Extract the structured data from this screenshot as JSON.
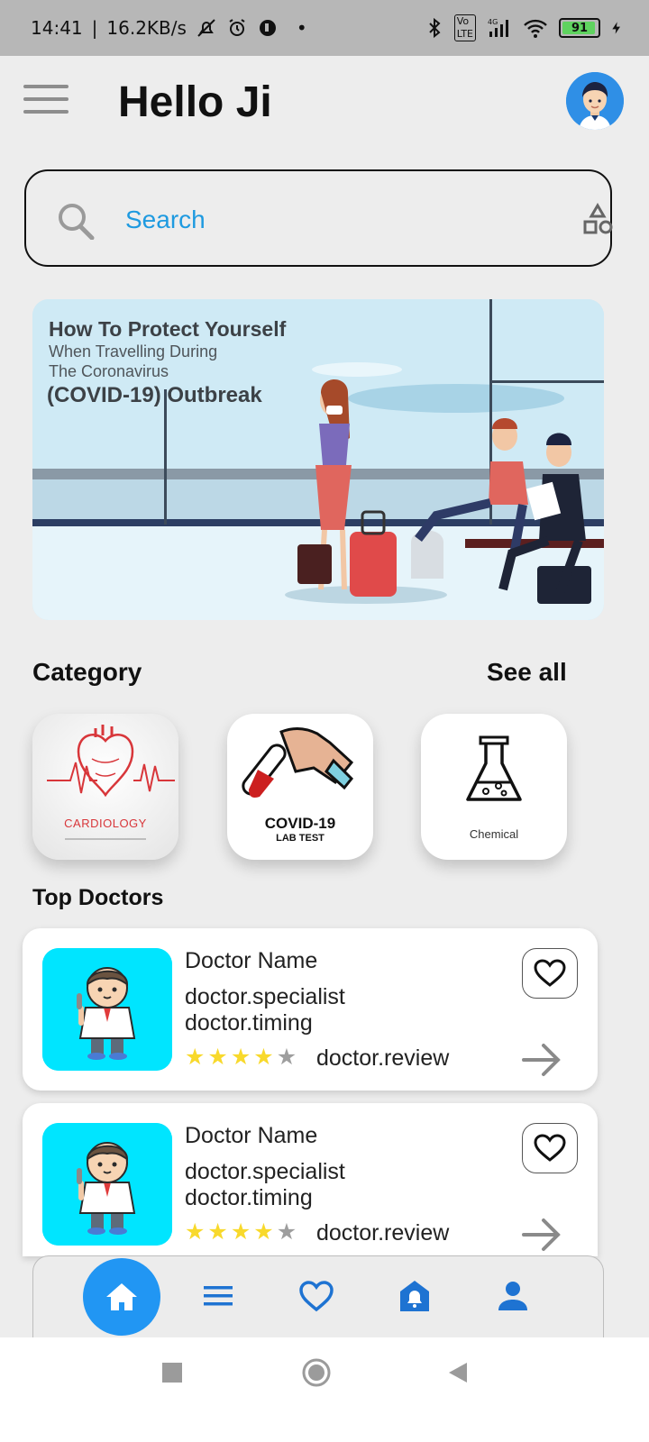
{
  "status_bar": {
    "time": "14:41",
    "speed": "16.2KB/s",
    "network_tag": "Vo LTE",
    "network_gen": "4G",
    "battery": "91"
  },
  "header": {
    "greeting": "Hello Ji"
  },
  "search": {
    "placeholder": "Search"
  },
  "banner": {
    "line1": "How To Protect Yourself",
    "line2": "When Travelling During",
    "line3": "The Coronavirus",
    "line4": "(COVID-19) Outbreak"
  },
  "category": {
    "title": "Category",
    "see_all": "See all",
    "items": [
      {
        "label": "CARDIOLOGY"
      },
      {
        "label": "COVID-19",
        "sublabel": "LAB TEST"
      },
      {
        "label": "Chemical"
      }
    ]
  },
  "top_doctors": {
    "title": "Top Doctors",
    "items": [
      {
        "name": "Doctor Name",
        "specialist": "doctor.specialist",
        "timing": "doctor.timing",
        "review": "doctor.review",
        "rating": 4
      },
      {
        "name": "Doctor Name",
        "specialist": "doctor.specialist",
        "timing": "doctor.timing",
        "review": "doctor.review",
        "rating": 4
      }
    ]
  },
  "bottom_nav": {
    "items": [
      "home-icon",
      "menu-icon",
      "heart-icon",
      "notification-icon",
      "profile-icon"
    ],
    "active": "home-icon",
    "accent": "#2196f3"
  },
  "colors": {
    "search_text": "#1e9ae0",
    "doctor_bg": "#00e5ff",
    "star_on": "#f8d92c"
  }
}
